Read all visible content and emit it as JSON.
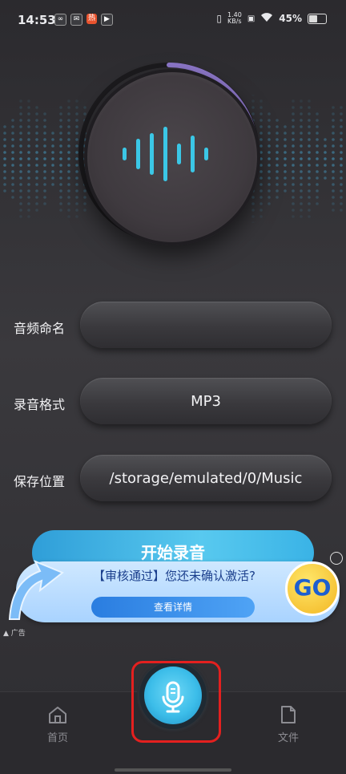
{
  "status_bar": {
    "time": "14:53",
    "net_speed": "1.40\nKB/s",
    "battery": "45%"
  },
  "form": {
    "name_label": "音频命名",
    "name_value": "",
    "format_label": "录音格式",
    "format_value": "MP3",
    "location_label": "保存位置",
    "location_value": "/storage/emulated/0/Music"
  },
  "start_button": "开始录音",
  "ad": {
    "title": "【审核通过】您还未确认激活?",
    "button": "查看详情",
    "go_badge": "GO",
    "tag": "广告"
  },
  "nav": {
    "home": "首页",
    "files": "文件"
  },
  "colors": {
    "accent": "#3bc7e6",
    "ring": "#8f79cc",
    "highlight": "#e4201f"
  }
}
